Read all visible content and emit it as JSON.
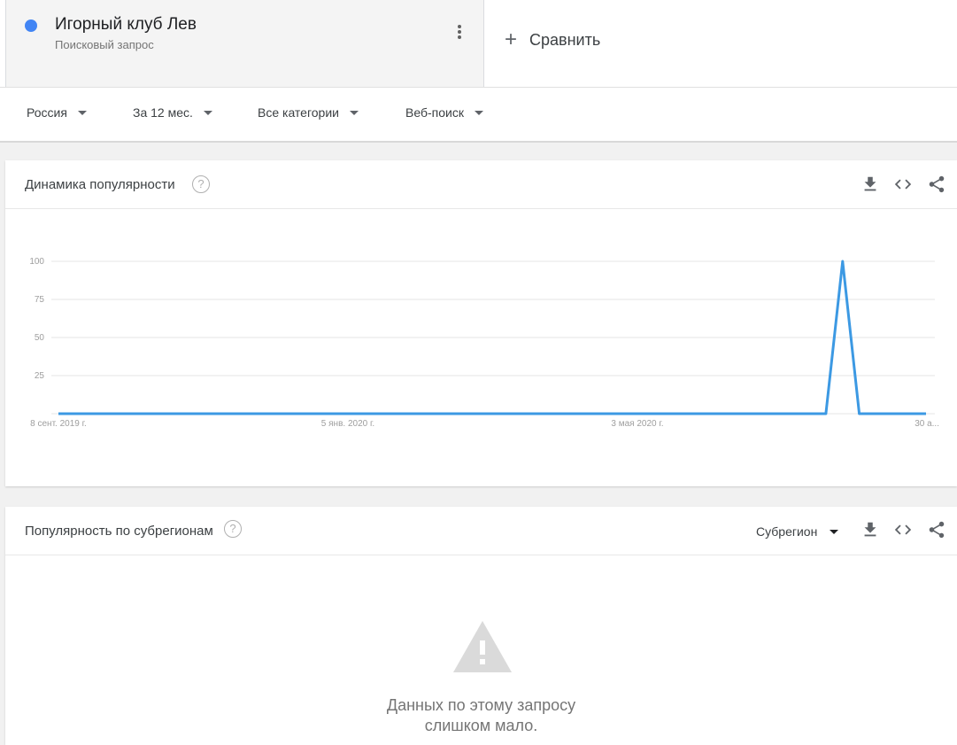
{
  "term": {
    "title": "Игорный клуб Лев",
    "subtitle": "Поисковый запрос",
    "dot_color": "#4285f4"
  },
  "compare_label": "Сравнить",
  "filters": [
    {
      "label": "Россия"
    },
    {
      "label": "За 12 мес."
    },
    {
      "label": "Все категории"
    },
    {
      "label": "Веб-поиск"
    }
  ],
  "interest_over_time": {
    "title": "Динамика популярности",
    "help_glyph": "?",
    "icons": [
      "download-icon",
      "embed-icon",
      "share-icon"
    ]
  },
  "chart_data": {
    "type": "line",
    "ylim": [
      0,
      100
    ],
    "y_ticks": [
      "25",
      "50",
      "75",
      "100"
    ],
    "x_tick_labels": [
      "8 сент. 2019 г.",
      "5 янв. 2020 г.",
      "3 мая 2020 г.",
      "30 а..."
    ],
    "series": [
      {
        "color": "#3c99e3",
        "values": [
          0,
          0,
          0,
          0,
          0,
          0,
          0,
          0,
          0,
          0,
          0,
          0,
          0,
          0,
          0,
          0,
          0,
          0,
          0,
          0,
          0,
          0,
          0,
          0,
          0,
          0,
          0,
          0,
          0,
          0,
          0,
          0,
          0,
          0,
          0,
          0,
          0,
          0,
          0,
          0,
          0,
          0,
          0,
          0,
          0,
          0,
          0,
          100,
          0,
          0,
          0,
          0,
          0
        ]
      }
    ],
    "grid": true
  },
  "subregion": {
    "title": "Популярность по субрегионам",
    "help_glyph": "?",
    "select_label": "Субрегион",
    "nodata_line1": "Данных по этому запросу",
    "nodata_line2": "слишком мало."
  }
}
